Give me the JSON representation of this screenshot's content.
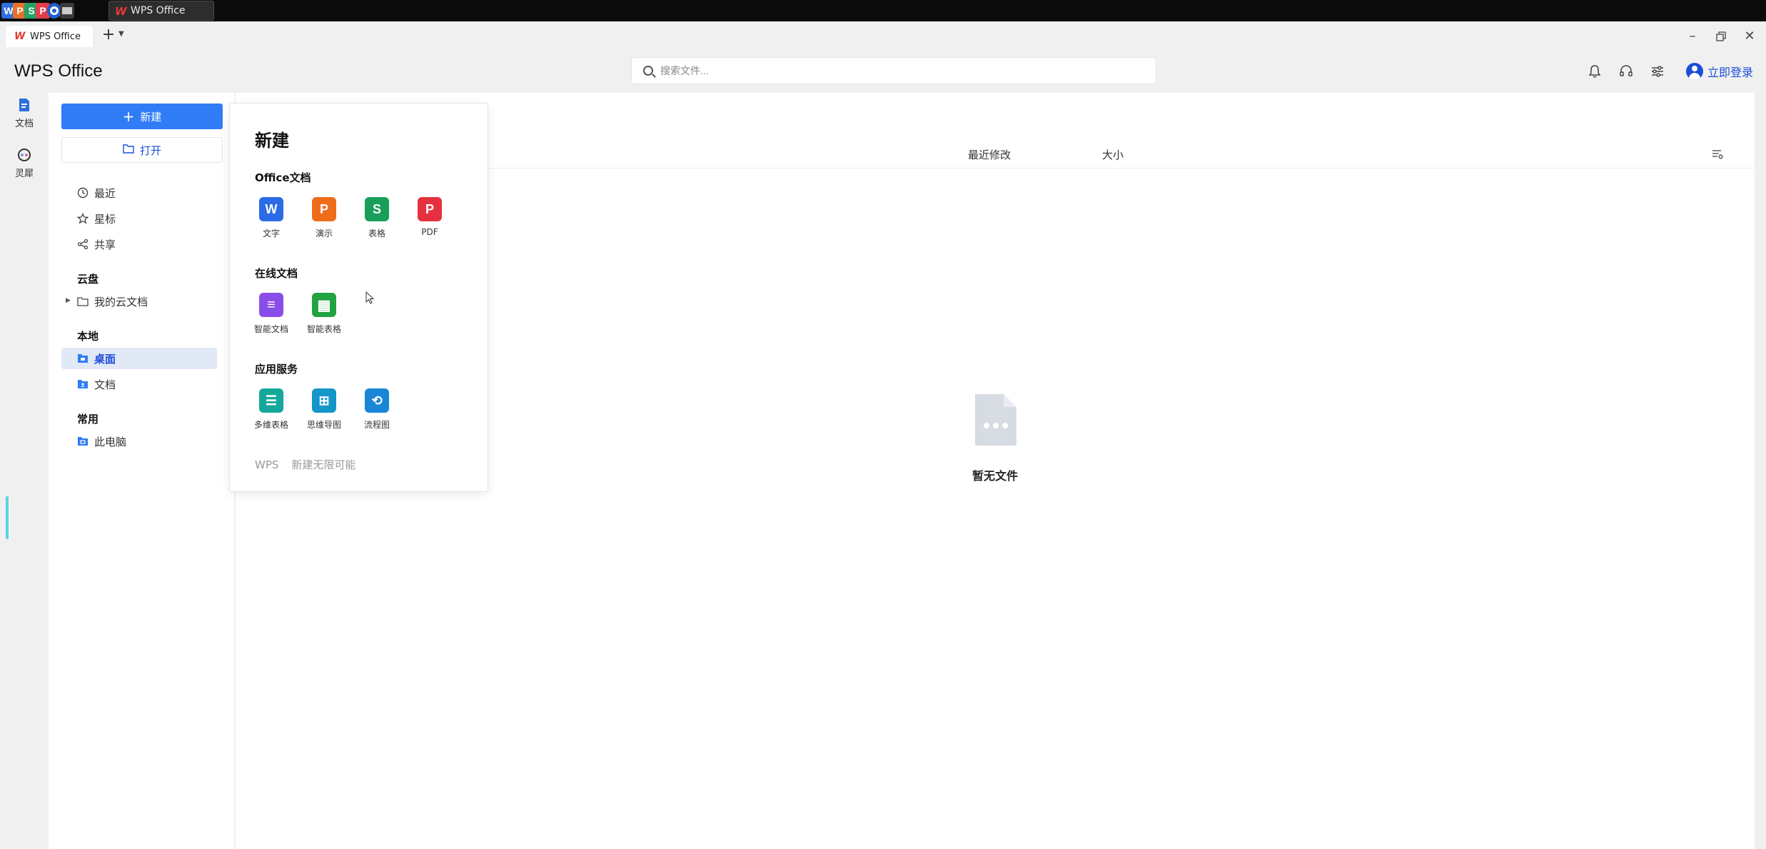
{
  "taskbar": {
    "apps": [
      {
        "name": "wps-writer",
        "glyph": "W",
        "color": "#2f6fdc"
      },
      {
        "name": "wps-presentation",
        "glyph": "P",
        "color": "#e8702a"
      },
      {
        "name": "wps-spreadsheet",
        "glyph": "S",
        "color": "#21a366"
      },
      {
        "name": "wps-pdf",
        "glyph": "P",
        "color": "#e43d4a"
      }
    ],
    "active_task": "WPS Office"
  },
  "tabbar": {
    "tab_label": "WPS Office",
    "add_tab": "+"
  },
  "header": {
    "app_title": "WPS Office",
    "search_placeholder": "搜索文件...",
    "login_label": "立即登录"
  },
  "rail": {
    "items": [
      {
        "label": "文档",
        "icon": "document-icon"
      },
      {
        "label": "灵犀",
        "icon": "lingxi-icon"
      }
    ]
  },
  "sidebar": {
    "new_label": "新建",
    "open_label": "打开",
    "items": [
      {
        "label": "最近",
        "icon": "clock-icon"
      },
      {
        "label": "星标",
        "icon": "star-icon"
      },
      {
        "label": "共享",
        "icon": "share-icon"
      }
    ],
    "cloud_heading": "云盘",
    "cloud_item": "我的云文档",
    "local_heading": "本地",
    "local_items": [
      {
        "label": "桌面",
        "icon": "desktop-folder-icon",
        "active": true
      },
      {
        "label": "文档",
        "icon": "documents-folder-icon",
        "active": false
      }
    ],
    "common_heading": "常用",
    "common_item": "此电脑"
  },
  "main": {
    "columns": [
      "最近修改",
      "大小"
    ],
    "empty_text": "暂无文件"
  },
  "new_popover": {
    "title": "新建",
    "sections": [
      {
        "heading": "Office文档",
        "tiles": [
          {
            "label": "文字",
            "glyph": "W",
            "color": "#2b6be6"
          },
          {
            "label": "演示",
            "glyph": "P",
            "color": "#ef6c1a"
          },
          {
            "label": "表格",
            "glyph": "S",
            "color": "#1a9f5a"
          },
          {
            "label": "PDF",
            "glyph": "P",
            "color": "#e5313f"
          }
        ]
      },
      {
        "heading": "在线文档",
        "tiles": [
          {
            "label": "智能文档",
            "glyph": "≡",
            "color": "#8a4ee8"
          },
          {
            "label": "智能表格",
            "glyph": "▦",
            "color": "#21a340"
          }
        ]
      },
      {
        "heading": "应用服务",
        "tiles": [
          {
            "label": "多维表格",
            "glyph": "☰",
            "color": "#14a89a"
          },
          {
            "label": "思维导图",
            "glyph": "⊞",
            "color": "#1596c9"
          },
          {
            "label": "流程图",
            "glyph": "⟲",
            "color": "#1a86d8"
          }
        ]
      }
    ],
    "footer": [
      "WPS",
      "新建无限可能"
    ]
  }
}
